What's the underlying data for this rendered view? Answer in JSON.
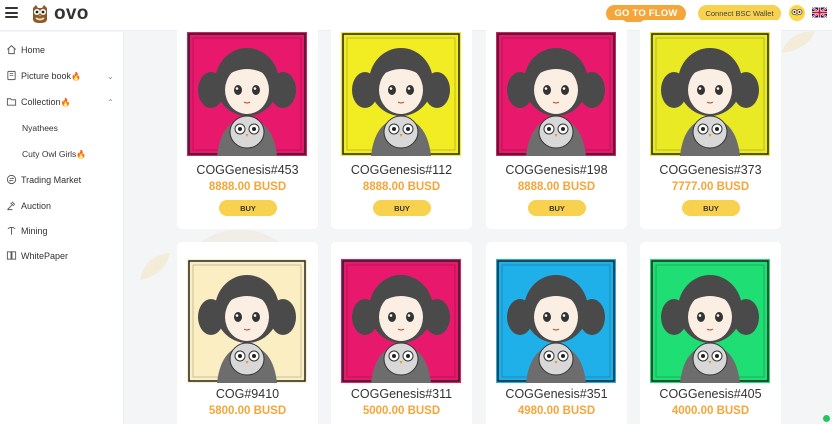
{
  "header": {
    "logo_text": "ovo",
    "goto_button": "GO TO FLOW",
    "wallet_button": "Connect BSC Wallet",
    "icons": {
      "menu": "menu-icon",
      "logo": "owl-logo-icon",
      "avatar": "owl-avatar-icon",
      "language": "uk-flag-icon"
    },
    "accent_color": "#f5a63a",
    "wallet_color": "#f8d14e"
  },
  "sidebar": {
    "items": [
      {
        "label": "Home",
        "icon": "home-icon"
      },
      {
        "label": "Picture book",
        "icon": "book-icon",
        "badge": "🔥",
        "chevron": "⌄"
      },
      {
        "label": "Collection",
        "icon": "collection-icon",
        "badge": "🔥",
        "chevron": "⌃"
      },
      {
        "label": "Trading Market",
        "icon": "trading-icon"
      },
      {
        "label": "Auction",
        "icon": "auction-icon"
      },
      {
        "label": "Mining",
        "icon": "mining-icon"
      },
      {
        "label": "WhitePaper",
        "icon": "whitepaper-icon"
      }
    ],
    "subitems": [
      {
        "label": "Nyathees"
      },
      {
        "label": "Cuty Owl Girls",
        "badge": "🔥"
      }
    ]
  },
  "cards": [
    {
      "name": "COGGenesis#453",
      "price": "8888.00 BUSD",
      "buy": "BUY",
      "bg": "#e8196d"
    },
    {
      "name": "COGGenesis#112",
      "price": "8888.00 BUSD",
      "buy": "BUY",
      "bg": "#f2ec22"
    },
    {
      "name": "COGGenesis#198",
      "price": "8888.00 BUSD",
      "buy": "BUY",
      "bg": "#e8196d"
    },
    {
      "name": "COGGenesis#373",
      "price": "7777.00 BUSD",
      "buy": "BUY",
      "bg": "#eaea24"
    },
    {
      "name": "COG#9410",
      "price": "5800.00 BUSD",
      "bg": "#fbeec2"
    },
    {
      "name": "COGGenesis#311",
      "price": "5000.00 BUSD",
      "bg": "#e8196d"
    },
    {
      "name": "COGGenesis#351",
      "price": "4980.00 BUSD",
      "bg": "#1fb0ea"
    },
    {
      "name": "COGGenesis#405",
      "price": "4000.00 BUSD",
      "bg": "#1ede74"
    }
  ]
}
